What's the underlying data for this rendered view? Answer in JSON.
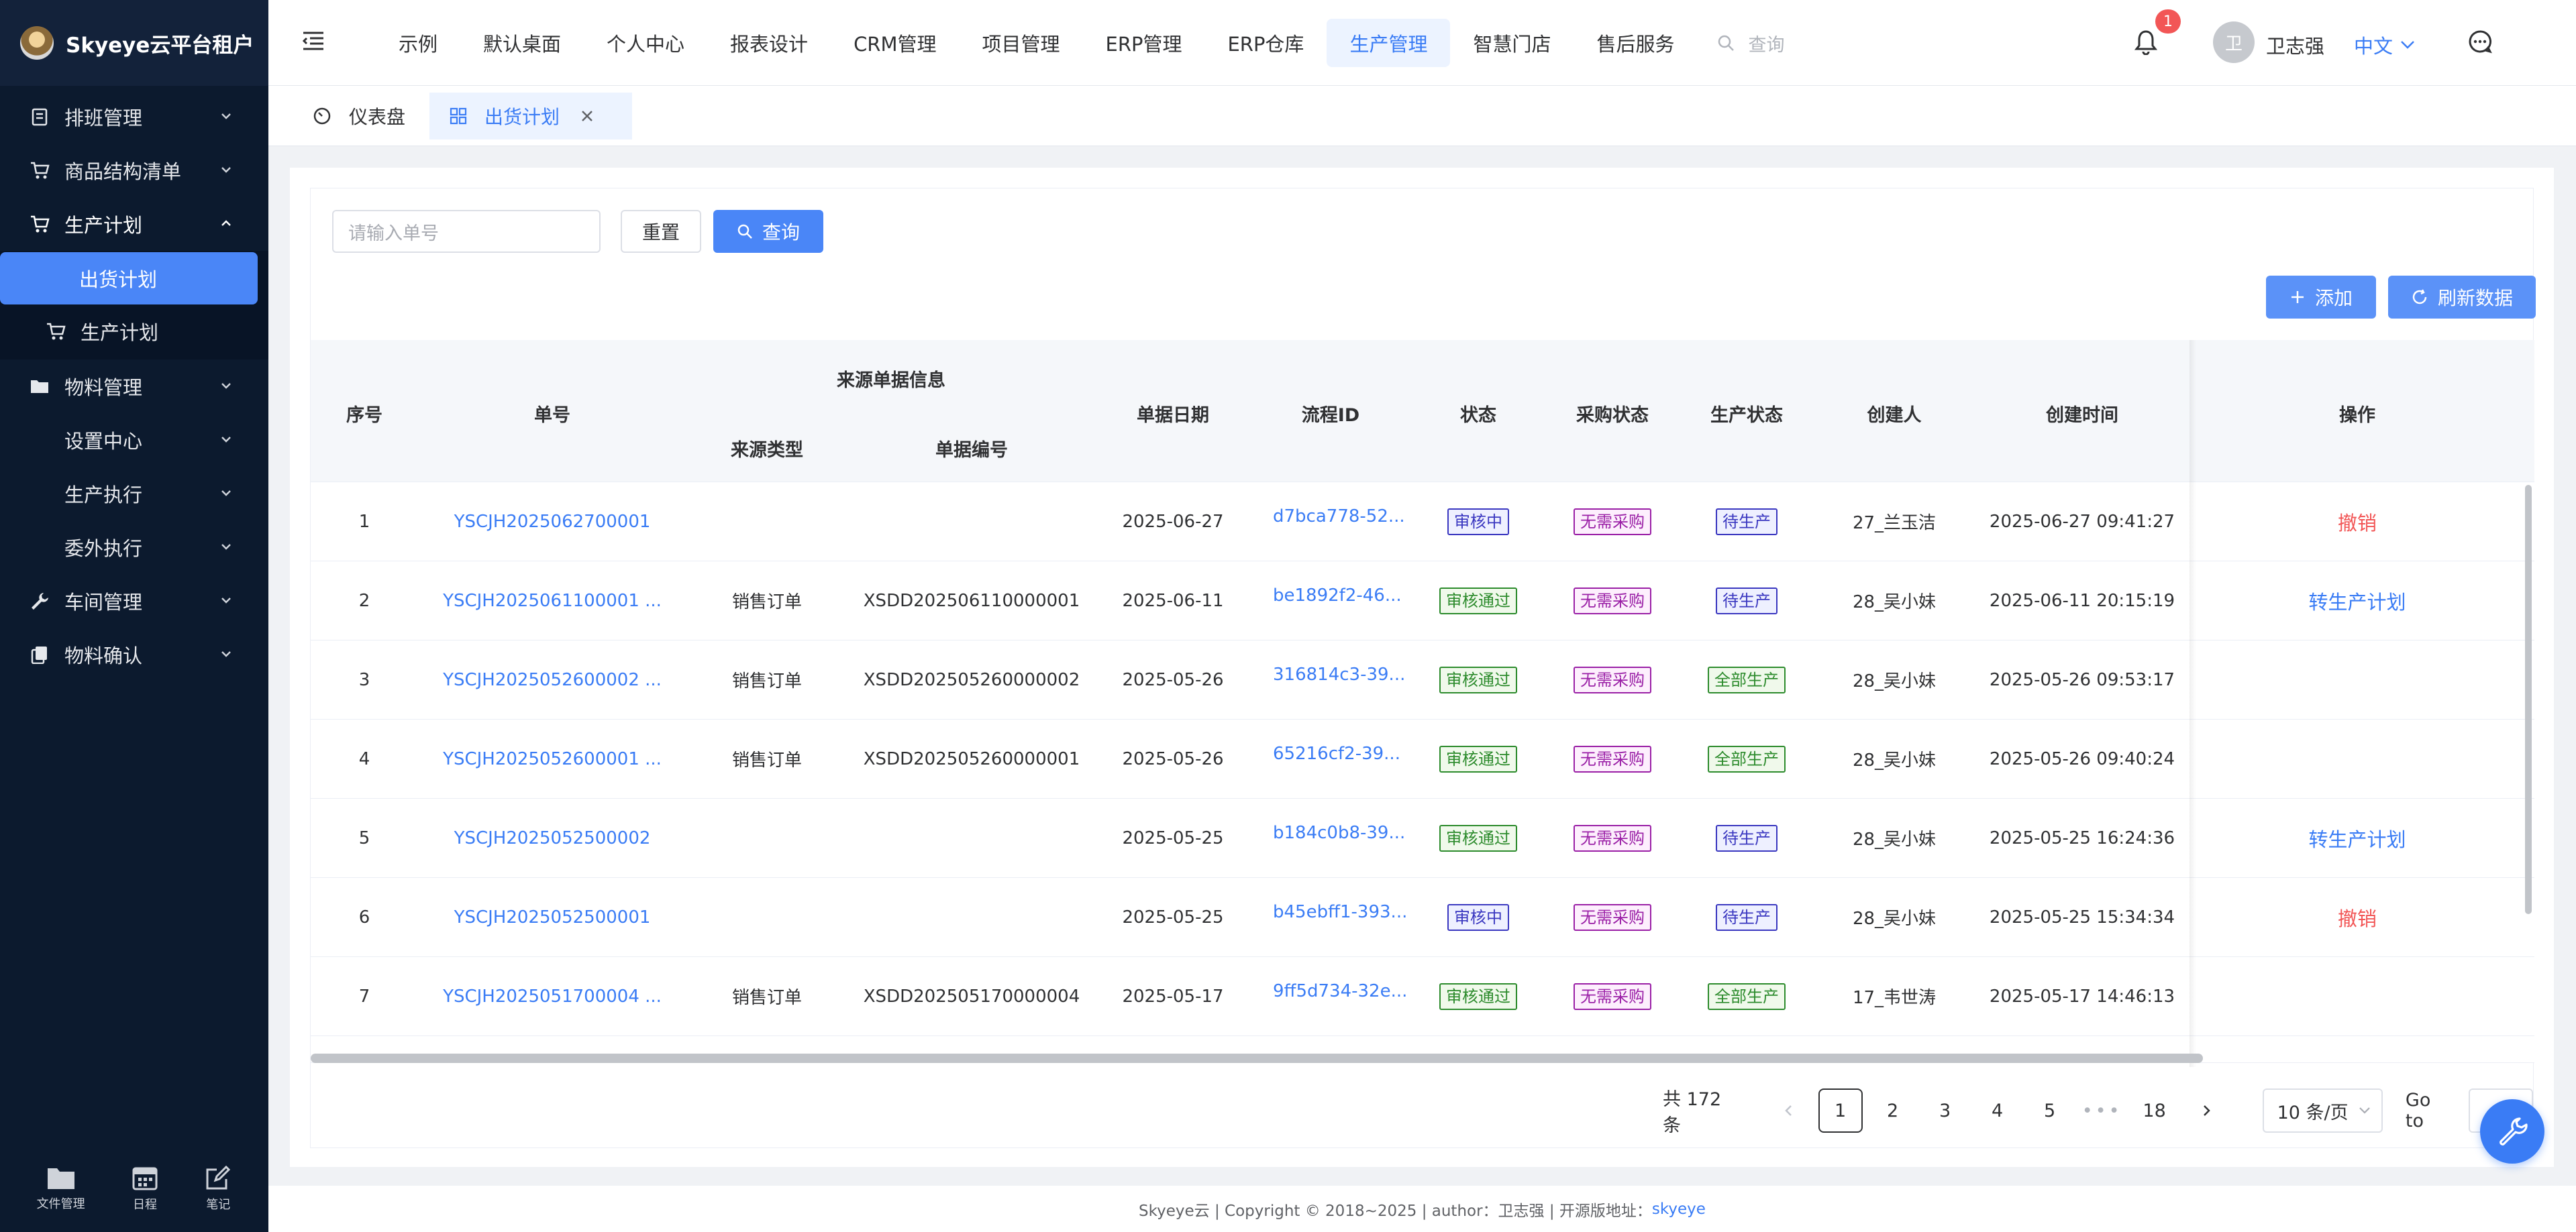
{
  "app": {
    "title": "Skyeye云平台租户"
  },
  "sidebar": {
    "items": [
      {
        "label": "排班管理"
      },
      {
        "label": "商品结构清单"
      },
      {
        "label": "生产计划"
      },
      {
        "label": "出货计划"
      },
      {
        "label": "生产计划"
      },
      {
        "label": "物料管理"
      },
      {
        "label": "设置中心"
      },
      {
        "label": "生产执行"
      },
      {
        "label": "委外执行"
      },
      {
        "label": "车间管理"
      },
      {
        "label": "物料确认"
      }
    ],
    "footer": [
      {
        "label": "文件管理"
      },
      {
        "label": "日程"
      },
      {
        "label": "笔记"
      }
    ]
  },
  "topnav": {
    "items": [
      "示例",
      "默认桌面",
      "个人中心",
      "报表设计",
      "CRM管理",
      "项目管理",
      "ERP管理",
      "ERP仓库",
      "生产管理",
      "智慧门店",
      "售后服务"
    ],
    "active_index": 8,
    "search_placeholder": "查询",
    "badge_count": "1",
    "avatar_text": "卫",
    "username": "卫志强",
    "language": "中文"
  },
  "tabs": [
    {
      "label": "仪表盘"
    },
    {
      "label": "出货计划"
    }
  ],
  "toolbar": {
    "search_placeholder": "请输入单号",
    "reset_label": "重置",
    "query_label": "查询",
    "add_label": "添加",
    "refresh_label": "刷新数据"
  },
  "table": {
    "headers": {
      "index": "序号",
      "order_no": "单号",
      "source_group": "来源单据信息",
      "source_type": "来源类型",
      "source_no": "单据编号",
      "date": "单据日期",
      "flow_id": "流程ID",
      "status": "状态",
      "purchase_status": "采购状态",
      "production_status": "生产状态",
      "creator": "创建人",
      "created_time": "创建时间",
      "actions": "操作"
    },
    "rows": [
      {
        "index": "1",
        "order_no": "YSCJH2025062700001",
        "source_type": "",
        "source_no": "",
        "date": "2025-06-27",
        "flow_id": "d7bca778-52...",
        "status": "审核中",
        "purchase": "无需采购",
        "production": "待生产",
        "creator": "27_兰玉洁",
        "created": "2025-06-27 09:41:27",
        "action": "撤销"
      },
      {
        "index": "2",
        "order_no": "YSCJH2025061100001 ...",
        "source_type": "销售订单",
        "source_no": "XSDD202506110000001",
        "date": "2025-06-11",
        "flow_id": "be1892f2-46...",
        "status": "审核通过",
        "purchase": "无需采购",
        "production": "待生产",
        "creator": "28_吴小妹",
        "created": "2025-06-11 20:15:19",
        "action": "转生产计划"
      },
      {
        "index": "3",
        "order_no": "YSCJH2025052600002 ...",
        "source_type": "销售订单",
        "source_no": "XSDD202505260000002",
        "date": "2025-05-26",
        "flow_id": "316814c3-39...",
        "status": "审核通过",
        "purchase": "无需采购",
        "production": "全部生产",
        "creator": "28_吴小妹",
        "created": "2025-05-26 09:53:17",
        "action": ""
      },
      {
        "index": "4",
        "order_no": "YSCJH2025052600001 ...",
        "source_type": "销售订单",
        "source_no": "XSDD202505260000001",
        "date": "2025-05-26",
        "flow_id": "65216cf2-39...",
        "status": "审核通过",
        "purchase": "无需采购",
        "production": "全部生产",
        "creator": "28_吴小妹",
        "created": "2025-05-26 09:40:24",
        "action": ""
      },
      {
        "index": "5",
        "order_no": "YSCJH2025052500002",
        "source_type": "",
        "source_no": "",
        "date": "2025-05-25",
        "flow_id": "b184c0b8-39...",
        "status": "审核通过",
        "purchase": "无需采购",
        "production": "待生产",
        "creator": "28_吴小妹",
        "created": "2025-05-25 16:24:36",
        "action": "转生产计划"
      },
      {
        "index": "6",
        "order_no": "YSCJH2025052500001",
        "source_type": "",
        "source_no": "",
        "date": "2025-05-25",
        "flow_id": "b45ebff1-393...",
        "status": "审核中",
        "purchase": "无需采购",
        "production": "待生产",
        "creator": "28_吴小妹",
        "created": "2025-05-25 15:34:34",
        "action": "撤销"
      },
      {
        "index": "7",
        "order_no": "YSCJH2025051700004 ...",
        "source_type": "销售订单",
        "source_no": "XSDD202505170000004",
        "date": "2025-05-17",
        "flow_id": "9ff5d734-32e...",
        "status": "审核通过",
        "purchase": "无需采购",
        "production": "全部生产",
        "creator": "17_韦世涛",
        "created": "2025-05-17 14:46:13",
        "action": ""
      }
    ]
  },
  "pagination": {
    "total": "共 172 条",
    "pages": [
      "1",
      "2",
      "3",
      "4",
      "5",
      "18"
    ],
    "more": "•••",
    "page_size": "10 条/页",
    "goto_label": "Go to"
  },
  "footer": {
    "text": "Skyeye云 | Copyright © 2018~2025 | author：卫志强 | 开源版地址：",
    "link": "skyeye"
  },
  "colors": {
    "accent": "#4a86f7",
    "sidebar_bg": "#0c1a2e",
    "danger": "#f25656",
    "tag_blue": "#3a37c0",
    "tag_green": "#2c8b2c",
    "tag_purple": "#9a1fa6"
  }
}
